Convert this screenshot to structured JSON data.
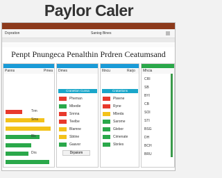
{
  "app_title": "Paylor Caler",
  "page_subtitle": "Penpt Pnungeca Penalthin Prdren Ceatumsand",
  "toolbar": {
    "item1": "Dcpration",
    "item2": "Saniog Bines"
  },
  "panels": [
    {
      "accent": "#1a9bd7",
      "col1": "Panns",
      "col2": "Pmea"
    },
    {
      "accent": "#1a9bd7",
      "col1": "Dmes",
      "col2": ""
    },
    {
      "accent": "#1a9bd7",
      "col1": "Iltncu",
      "col2": "Rarjo"
    },
    {
      "accent": "#2aa84a",
      "col1": "Mhcia",
      "col2": ""
    }
  ],
  "bars": [
    {
      "color": "#e8392c",
      "level": 0.35,
      "label": "Trm"
    },
    {
      "color": "#f3c21a",
      "level": 0.82,
      "label": "Sms"
    },
    {
      "color": "#f3c21a",
      "level": 0.95,
      "label": ""
    },
    {
      "color": "#2aa84a",
      "level": 0.72,
      "label": "Blc"
    },
    {
      "color": "#2aa84a",
      "level": 0.55,
      "label": ""
    },
    {
      "color": "#2aa84a",
      "level": 0.48,
      "label": "Drs"
    },
    {
      "color": "#2aa84a",
      "level": 0.92,
      "label": ""
    }
  ],
  "panel2_header": "Cranetion Cunsa",
  "panel2_rows": [
    {
      "color": "#e8392c",
      "label": "Pheman"
    },
    {
      "color": "#2aa84a",
      "label": "Mbedie"
    },
    {
      "color": "#e8392c",
      "label": "Snnna"
    },
    {
      "color": "#e8392c",
      "label": "Teelbe"
    },
    {
      "color": "#f3c21a",
      "label": "Blamne"
    },
    {
      "color": "#f3c21a",
      "label": "Sbtine"
    },
    {
      "color": "#2aa84a",
      "label": "Gaavsr"
    }
  ],
  "panel2_footer": "Drpsiom",
  "panel3_header": "Cratartions",
  "panel3_rows": [
    {
      "color": "#e8392c",
      "label": "Plwene"
    },
    {
      "color": "#e8392c",
      "label": "Ryne"
    },
    {
      "color": "#f3c21a",
      "label": "Mbeda"
    },
    {
      "color": "#2aa84a",
      "label": "Sarome"
    },
    {
      "color": "#2aa84a",
      "label": "Glebor"
    },
    {
      "color": "#2aa84a",
      "label": "Cimenate"
    },
    {
      "color": "#2aa84a",
      "label": "Sbnles"
    }
  ],
  "panel4_rows": [
    "CRI",
    "SB",
    "BYl",
    "CB",
    "SOI",
    "STI",
    "BSG",
    "DH",
    "BCH",
    "BRU"
  ]
}
